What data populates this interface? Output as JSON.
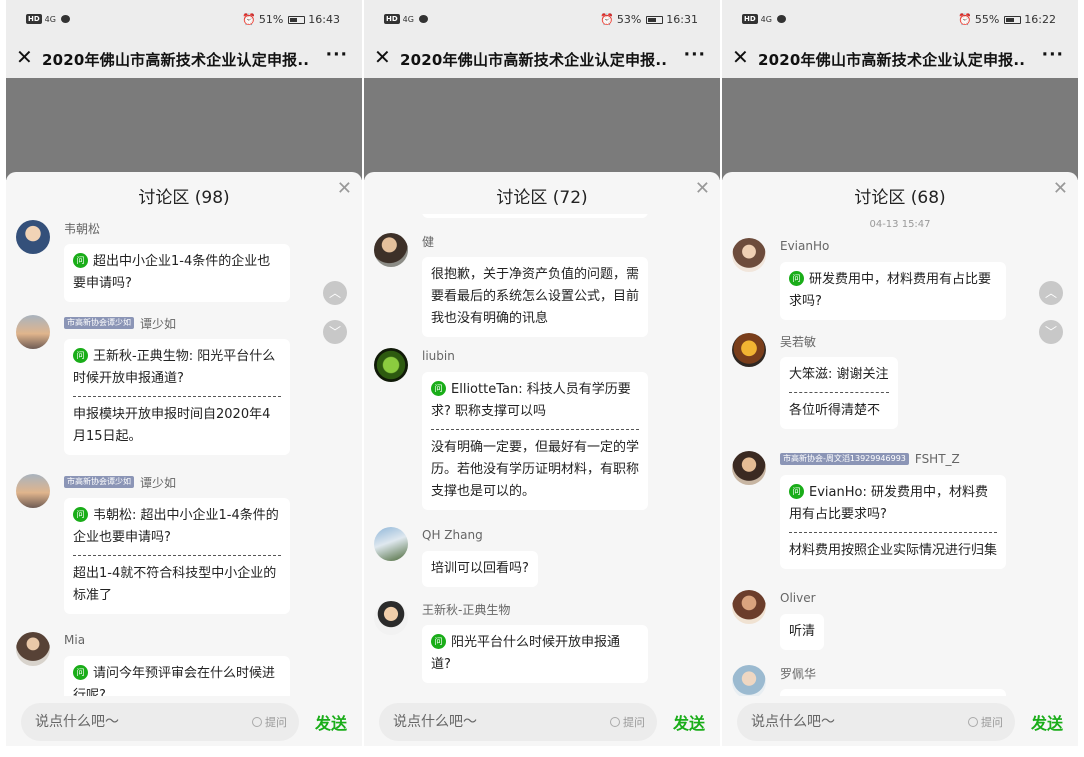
{
  "colors": {
    "accent_green": "#1aad19",
    "video_gray": "#7b7b7b",
    "badge_bg": "#8b95b6"
  },
  "icons": {
    "close": "close-icon",
    "more": "more-icon",
    "question": "question-icon",
    "scroll_up": "chevron-up-icon",
    "scroll_down": "chevron-down-icon"
  },
  "common": {
    "title": "2020年佛山市高新技术企业认定申报...",
    "close_glyph": "✕",
    "more_glyph": "···",
    "sheet_close_glyph": "✕",
    "q_icon": "问",
    "input_placeholder": "说点什么吧～",
    "ask_label": "提问",
    "send_label": "发送",
    "network": "4G",
    "hd": "HD",
    "up_glyph": "︿",
    "down_glyph": "﹀"
  },
  "panels": [
    {
      "status": {
        "battery": "51%",
        "battery_level": 0.51,
        "time": "16:43"
      },
      "sheet_title": "讨论区 (98)",
      "messages": [
        {
          "name": "韦朝松",
          "badge": "",
          "question": "超出中小企业1-4条件的企业也要申请吗?",
          "answer": ""
        },
        {
          "name": "谭少如",
          "badge": "市高新协会谭少如",
          "question": "王新秋-正典生物: 阳光平台什么时候开放申报通道?",
          "answer": "申报模块开放申报时间自2020年4月15日起。"
        },
        {
          "name": "谭少如",
          "badge": "市高新协会谭少如",
          "question": "韦朝松: 超出中小企业1-4条件的企业也要申请吗?",
          "answer": "超出1-4就不符合科技型中小企业的标准了"
        },
        {
          "name": "Mia",
          "badge": "",
          "question": "请问今年预评审会在什么时候进行呢?",
          "answer": ""
        }
      ]
    },
    {
      "status": {
        "battery": "53%",
        "battery_level": 0.53,
        "time": "16:31"
      },
      "sheet_title": "讨论区 (72)",
      "messages": [
        {
          "name": "健",
          "badge": "",
          "question": "",
          "answer": "很抱歉，关于净资产负值的问题，需要看最后的系统怎么设置公式，目前我也没有明确的讯息"
        },
        {
          "name": "liubin",
          "badge": "",
          "question": "ElliotteTan: 科技人员有学历要求? 职称支撑可以吗",
          "answer": "没有明确一定要，但最好有一定的学历。若他没有学历证明材料，有职称支撑也是可以的。"
        },
        {
          "name": "QH Zhang",
          "badge": "",
          "question": "",
          "answer": "培训可以回看吗?"
        },
        {
          "name": "王新秋-正典生物",
          "badge": "",
          "question": "阳光平台什么时候开放申报通道?",
          "answer": ""
        }
      ]
    },
    {
      "status": {
        "battery": "55%",
        "battery_level": 0.55,
        "time": "16:22"
      },
      "sheet_title": "讨论区 (68)",
      "time_label": "04-13 15:47",
      "messages": [
        {
          "name": "EvianHo",
          "badge": "",
          "question": "研发费用中，材料费用有占比要求吗?",
          "answer": ""
        },
        {
          "name": "吴若敏",
          "badge": "",
          "question": "",
          "answer": "大笨滋: 谢谢关注",
          "answer2": "各位听得清楚不"
        },
        {
          "name": "FSHT_Z",
          "badge": "市高新协会-周文滔13929946993",
          "question": "EvianHo: 研发费用中，材料费用有占比要求吗?",
          "answer": "材料费用按照企业实际情况进行归集"
        },
        {
          "name": "Oliver",
          "badge": "",
          "question": "",
          "answer": "听清"
        },
        {
          "name": "罗佩华",
          "badge": "",
          "question": "",
          "answer": ""
        }
      ]
    }
  ]
}
